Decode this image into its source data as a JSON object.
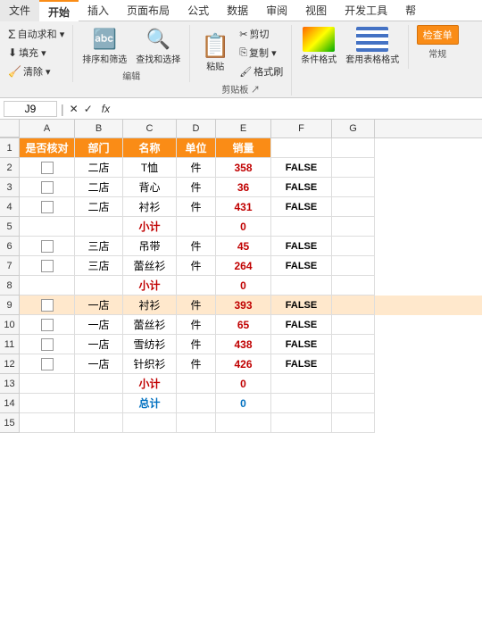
{
  "ribbon": {
    "tabs": [
      "文件",
      "开始",
      "插入",
      "页面布局",
      "公式",
      "数据",
      "审阅",
      "视图",
      "开发工具",
      "帮"
    ],
    "active_tab": "开始",
    "groups": {
      "clipboard": {
        "label": "剪贴板",
        "buttons": [
          "粘贴",
          "剪切",
          "复制",
          "格式刷"
        ]
      },
      "font": {
        "label": "编辑"
      },
      "edit": {
        "label": "编辑",
        "buttons": [
          "自动求和",
          "清除",
          "排序和筛选",
          "查找和选择"
        ]
      },
      "conditional": {
        "label": "条件格式",
        "button": "条件格式"
      },
      "style": {
        "label": "套用表格格式",
        "button": "套用表格格式"
      },
      "highlight": {
        "label": "检查单",
        "button": "检查单"
      }
    }
  },
  "formula_bar": {
    "cell_ref": "J9",
    "fx": "fx"
  },
  "columns": {
    "headers": [
      "",
      "A",
      "B",
      "C",
      "D",
      "E",
      "F",
      "G"
    ],
    "widths": [
      22,
      62,
      54,
      60,
      44,
      62,
      68,
      48
    ]
  },
  "rows": [
    {
      "num": 1,
      "cells": [
        {
          "col": "A",
          "text": "是否核对",
          "style": "orange"
        },
        {
          "col": "B",
          "text": "部门",
          "style": "orange"
        },
        {
          "col": "C",
          "text": "名称",
          "style": "orange"
        },
        {
          "col": "D",
          "text": "单位",
          "style": "orange"
        },
        {
          "col": "E",
          "text": "销量",
          "style": "orange"
        },
        {
          "col": "F",
          "text": "",
          "style": ""
        },
        {
          "col": "G",
          "text": "",
          "style": ""
        }
      ]
    },
    {
      "num": 2,
      "cells": [
        {
          "col": "A",
          "text": "checkbox",
          "style": ""
        },
        {
          "col": "B",
          "text": "二店",
          "style": ""
        },
        {
          "col": "C",
          "text": "T恤",
          "style": ""
        },
        {
          "col": "D",
          "text": "件",
          "style": ""
        },
        {
          "col": "E",
          "text": "358",
          "style": "bold"
        },
        {
          "col": "F",
          "text": "FALSE",
          "style": "false"
        },
        {
          "col": "G",
          "text": "",
          "style": ""
        }
      ]
    },
    {
      "num": 3,
      "cells": [
        {
          "col": "A",
          "text": "checkbox",
          "style": ""
        },
        {
          "col": "B",
          "text": "二店",
          "style": ""
        },
        {
          "col": "C",
          "text": "背心",
          "style": ""
        },
        {
          "col": "D",
          "text": "件",
          "style": ""
        },
        {
          "col": "E",
          "text": "36",
          "style": "bold"
        },
        {
          "col": "F",
          "text": "FALSE",
          "style": "false"
        },
        {
          "col": "G",
          "text": "",
          "style": ""
        }
      ]
    },
    {
      "num": 4,
      "cells": [
        {
          "col": "A",
          "text": "checkbox",
          "style": ""
        },
        {
          "col": "B",
          "text": "二店",
          "style": ""
        },
        {
          "col": "C",
          "text": "衬衫",
          "style": ""
        },
        {
          "col": "D",
          "text": "件",
          "style": ""
        },
        {
          "col": "E",
          "text": "431",
          "style": "bold"
        },
        {
          "col": "F",
          "text": "FALSE",
          "style": "false"
        },
        {
          "col": "G",
          "text": "",
          "style": ""
        }
      ]
    },
    {
      "num": 5,
      "cells": [
        {
          "col": "A",
          "text": "",
          "style": ""
        },
        {
          "col": "B",
          "text": "",
          "style": ""
        },
        {
          "col": "C",
          "text": "小计",
          "style": "subtotal-label"
        },
        {
          "col": "D",
          "text": "",
          "style": ""
        },
        {
          "col": "E",
          "text": "0",
          "style": "subtotal-value"
        },
        {
          "col": "F",
          "text": "",
          "style": ""
        },
        {
          "col": "G",
          "text": "",
          "style": ""
        }
      ]
    },
    {
      "num": 6,
      "cells": [
        {
          "col": "A",
          "text": "checkbox",
          "style": ""
        },
        {
          "col": "B",
          "text": "三店",
          "style": ""
        },
        {
          "col": "C",
          "text": "吊带",
          "style": ""
        },
        {
          "col": "D",
          "text": "件",
          "style": ""
        },
        {
          "col": "E",
          "text": "45",
          "style": "bold"
        },
        {
          "col": "F",
          "text": "FALSE",
          "style": "false"
        },
        {
          "col": "G",
          "text": "",
          "style": ""
        }
      ]
    },
    {
      "num": 7,
      "cells": [
        {
          "col": "A",
          "text": "checkbox",
          "style": ""
        },
        {
          "col": "B",
          "text": "三店",
          "style": ""
        },
        {
          "col": "C",
          "text": "蕾丝衫",
          "style": ""
        },
        {
          "col": "D",
          "text": "件",
          "style": ""
        },
        {
          "col": "E",
          "text": "264",
          "style": "bold"
        },
        {
          "col": "F",
          "text": "FALSE",
          "style": "false"
        },
        {
          "col": "G",
          "text": "",
          "style": ""
        }
      ]
    },
    {
      "num": 8,
      "cells": [
        {
          "col": "A",
          "text": "",
          "style": ""
        },
        {
          "col": "B",
          "text": "",
          "style": ""
        },
        {
          "col": "C",
          "text": "小计",
          "style": "subtotal-label"
        },
        {
          "col": "D",
          "text": "",
          "style": ""
        },
        {
          "col": "E",
          "text": "0",
          "style": "subtotal-value"
        },
        {
          "col": "F",
          "text": "",
          "style": ""
        },
        {
          "col": "G",
          "text": "",
          "style": ""
        }
      ]
    },
    {
      "num": 9,
      "cells": [
        {
          "col": "A",
          "text": "checkbox",
          "style": "highlight"
        },
        {
          "col": "B",
          "text": "一店",
          "style": ""
        },
        {
          "col": "C",
          "text": "衬衫",
          "style": ""
        },
        {
          "col": "D",
          "text": "件",
          "style": ""
        },
        {
          "col": "E",
          "text": "393",
          "style": "bold"
        },
        {
          "col": "F",
          "text": "FALSE",
          "style": "false"
        },
        {
          "col": "G",
          "text": "",
          "style": ""
        }
      ]
    },
    {
      "num": 10,
      "cells": [
        {
          "col": "A",
          "text": "checkbox",
          "style": ""
        },
        {
          "col": "B",
          "text": "一店",
          "style": ""
        },
        {
          "col": "C",
          "text": "蕾丝衫",
          "style": ""
        },
        {
          "col": "D",
          "text": "件",
          "style": ""
        },
        {
          "col": "E",
          "text": "65",
          "style": "bold"
        },
        {
          "col": "F",
          "text": "FALSE",
          "style": "false"
        },
        {
          "col": "G",
          "text": "",
          "style": ""
        }
      ]
    },
    {
      "num": 11,
      "cells": [
        {
          "col": "A",
          "text": "checkbox",
          "style": ""
        },
        {
          "col": "B",
          "text": "一店",
          "style": ""
        },
        {
          "col": "C",
          "text": "雪纺衫",
          "style": ""
        },
        {
          "col": "D",
          "text": "件",
          "style": ""
        },
        {
          "col": "E",
          "text": "438",
          "style": "bold"
        },
        {
          "col": "F",
          "text": "FALSE",
          "style": "false"
        },
        {
          "col": "G",
          "text": "",
          "style": ""
        }
      ]
    },
    {
      "num": 12,
      "cells": [
        {
          "col": "A",
          "text": "checkbox",
          "style": ""
        },
        {
          "col": "B",
          "text": "一店",
          "style": ""
        },
        {
          "col": "C",
          "text": "针织衫",
          "style": ""
        },
        {
          "col": "D",
          "text": "件",
          "style": ""
        },
        {
          "col": "E",
          "text": "426",
          "style": "bold"
        },
        {
          "col": "F",
          "text": "FALSE",
          "style": "false"
        },
        {
          "col": "G",
          "text": "",
          "style": ""
        }
      ]
    },
    {
      "num": 13,
      "cells": [
        {
          "col": "A",
          "text": "",
          "style": ""
        },
        {
          "col": "B",
          "text": "",
          "style": ""
        },
        {
          "col": "C",
          "text": "小计",
          "style": "subtotal-label"
        },
        {
          "col": "D",
          "text": "",
          "style": ""
        },
        {
          "col": "E",
          "text": "0",
          "style": "subtotal-value"
        },
        {
          "col": "F",
          "text": "",
          "style": ""
        },
        {
          "col": "G",
          "text": "",
          "style": ""
        }
      ]
    },
    {
      "num": 14,
      "cells": [
        {
          "col": "A",
          "text": "",
          "style": ""
        },
        {
          "col": "B",
          "text": "",
          "style": ""
        },
        {
          "col": "C",
          "text": "总计",
          "style": "total-label"
        },
        {
          "col": "D",
          "text": "",
          "style": ""
        },
        {
          "col": "E",
          "text": "0",
          "style": "total-value"
        },
        {
          "col": "F",
          "text": "",
          "style": ""
        },
        {
          "col": "G",
          "text": "",
          "style": ""
        }
      ]
    },
    {
      "num": 15,
      "cells": [
        {
          "col": "A",
          "text": "",
          "style": ""
        },
        {
          "col": "B",
          "text": "",
          "style": ""
        },
        {
          "col": "C",
          "text": "",
          "style": ""
        },
        {
          "col": "D",
          "text": "",
          "style": ""
        },
        {
          "col": "E",
          "text": "",
          "style": ""
        },
        {
          "col": "F",
          "text": "",
          "style": ""
        },
        {
          "col": "G",
          "text": "",
          "style": ""
        }
      ]
    }
  ]
}
